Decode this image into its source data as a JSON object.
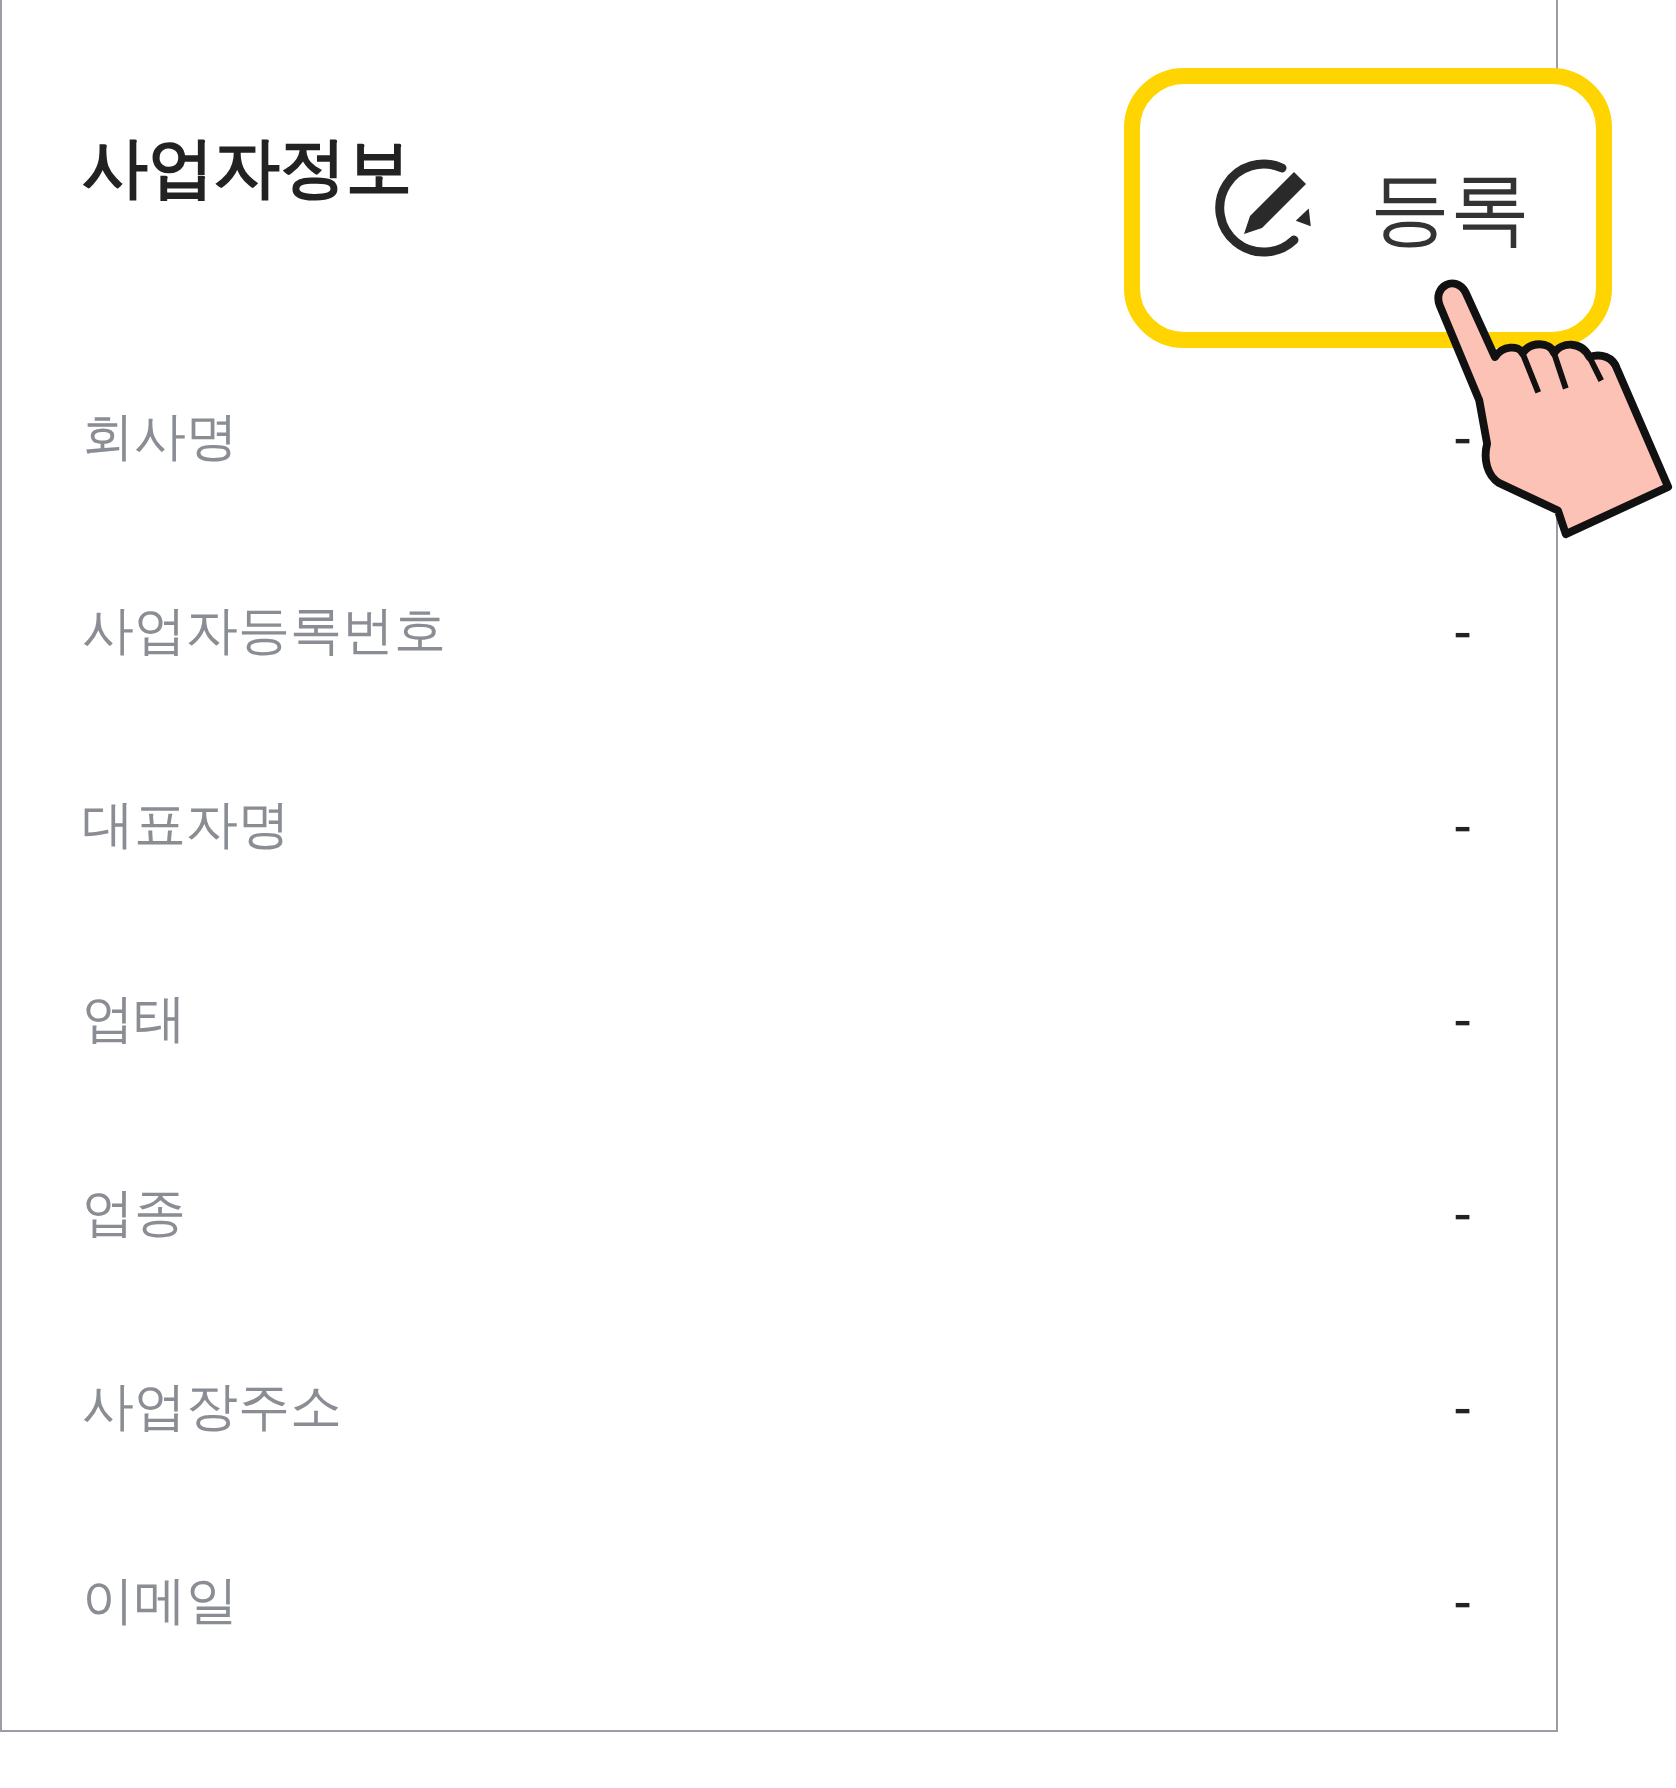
{
  "panel": {
    "title": "사업자정보",
    "fields": [
      {
        "label": "회사명",
        "value": "-"
      },
      {
        "label": "사업자등록번호",
        "value": "-"
      },
      {
        "label": "대표자명",
        "value": "-"
      },
      {
        "label": "업태",
        "value": "-"
      },
      {
        "label": "업종",
        "value": "-"
      },
      {
        "label": "사업장주소",
        "value": "-"
      },
      {
        "label": "이메일",
        "value": "-"
      }
    ]
  },
  "register_button": {
    "label": "등록",
    "highlighted": true
  }
}
